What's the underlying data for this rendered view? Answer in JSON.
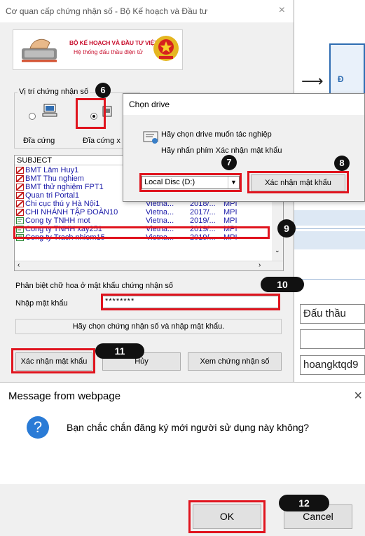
{
  "background_page": {
    "field_1": "Đấu thầu",
    "field_2": "",
    "field_3": "hoangktqd9",
    "blue_box_char": "Đ",
    "arrow": "⟶"
  },
  "main_dialog": {
    "title": "Cơ quan cấp chứng nhận số - Bộ Kế hoạch và Đầu tư",
    "close": "×",
    "banner": {
      "line1": "BỘ KẾ HOẠCH VÀ ĐẦU TƯ VIỆT NAM",
      "line2": "Hệ thống đấu thầu điện tử"
    },
    "location_group_label": "Vị trí chứng nhận số",
    "drives": [
      {
        "label": "Đĩa cứng",
        "selected": false
      },
      {
        "label": "Đĩa cứng x",
        "selected": true
      }
    ],
    "list": {
      "header": "SUBJECT",
      "rows": [
        {
          "subject": "BMT Lâm Huy1",
          "c2": "",
          "c3": "",
          "c4": "",
          "icon": "red-cert-icon"
        },
        {
          "subject": "BMT Thu nghiem",
          "c2": "",
          "c3": "",
          "c4": "",
          "icon": "red-cert-icon"
        },
        {
          "subject": "BMT thử nghiệm FPT1",
          "c2": "",
          "c3": "",
          "c4": "",
          "icon": "red-cert-icon"
        },
        {
          "subject": "Quan tri Portal1",
          "c2": "Vietna...",
          "c3": "2017/...",
          "c4": "MPI",
          "icon": "red-cert-icon"
        },
        {
          "subject": "Chi cục thú y Hà Nội1",
          "c2": "Vietna...",
          "c3": "2018/...",
          "c4": "MPI",
          "icon": "red-cert-icon"
        },
        {
          "subject": "CHI NHÁNH TẬP ĐOÀN10",
          "c2": "Vietna...",
          "c3": "2017/...",
          "c4": "MPI",
          "icon": "red-cert-icon"
        },
        {
          "subject": "Cong ty TNHH mot",
          "c2": "Vietna...",
          "c3": "2019/...",
          "c4": "MPI",
          "icon": "green-cert-icon"
        },
        {
          "subject": "Cong ty TNHH xay251",
          "c2": "Vietna...",
          "c3": "2019/...",
          "c4": "MPI",
          "icon": "green-cert-icon"
        },
        {
          "subject": "Cong ty Trach nhiem15",
          "c2": "Vietna...",
          "c3": "2019/...",
          "c4": "MPI",
          "icon": "green-cert-icon"
        }
      ]
    },
    "case_note": "Phân biệt chữ hoa ở mật khẩu chứng nhận số",
    "password_label": "Nhập mật khẩu",
    "password_value": "********",
    "status": "Hãy chọn chứng nhận số và nhập mật khẩu.",
    "buttons": {
      "confirm": "Xác nhận mật khẩu",
      "cancel": "Hủy",
      "view": "Xem chứng nhận số"
    }
  },
  "drive_dialog": {
    "title": "Chọn drive",
    "line1": "Hãy chọn drive muốn tác nghiệp",
    "line2": "Hãy nhấn phím Xác nhận mật khẩu",
    "selected_drive": "Local Disc (D:)",
    "confirm_button": "Xác nhận mật khẩu"
  },
  "message_dialog": {
    "title": "Message from webpage",
    "close": "×",
    "question": "Bạn chắc chắn đăng ký mới người sử dụng này không?",
    "ok": "OK",
    "cancel": "Cancel"
  },
  "step_badges": {
    "s6": "6",
    "s7": "7",
    "s8": "8",
    "s9": "9",
    "s10": "10",
    "s11": "11",
    "s12": "12"
  },
  "colors": {
    "highlight_red": "#e0141e",
    "badge_black": "#111111",
    "list_text_blue": "#1a1aa8",
    "accent_blue": "#2f6db2"
  }
}
